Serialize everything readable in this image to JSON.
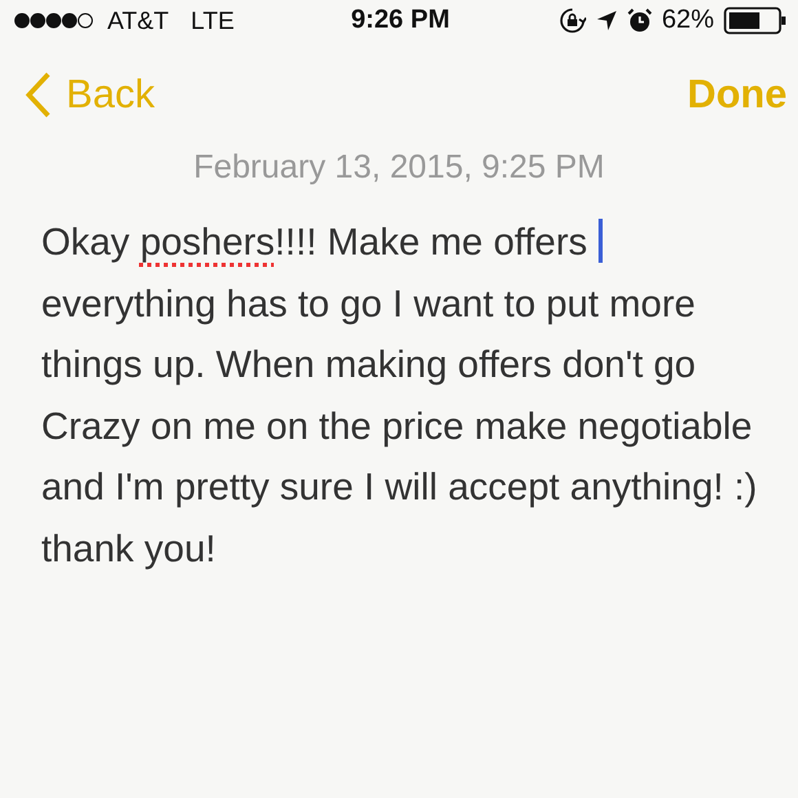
{
  "status_bar": {
    "carrier": "AT&T",
    "network": "LTE",
    "time": "9:26 PM",
    "battery_percent": "62%"
  },
  "nav": {
    "back": "Back",
    "done": "Done"
  },
  "note": {
    "date": "February 13, 2015, 9:25 PM",
    "segments": [
      {
        "text": "Okay ",
        "misspelled": false,
        "cursor_after": false
      },
      {
        "text": "poshers",
        "misspelled": true,
        "cursor_after": false
      },
      {
        "text": "!!!! Make me offers",
        "misspelled": false,
        "cursor_after": true
      },
      {
        "text": " everything has to go I want to put more things up. When making offers don't go Crazy on me on the price make negotiable and I'm pretty sure I will accept anything! :) thank you!",
        "misspelled": false,
        "cursor_after": false
      }
    ]
  }
}
